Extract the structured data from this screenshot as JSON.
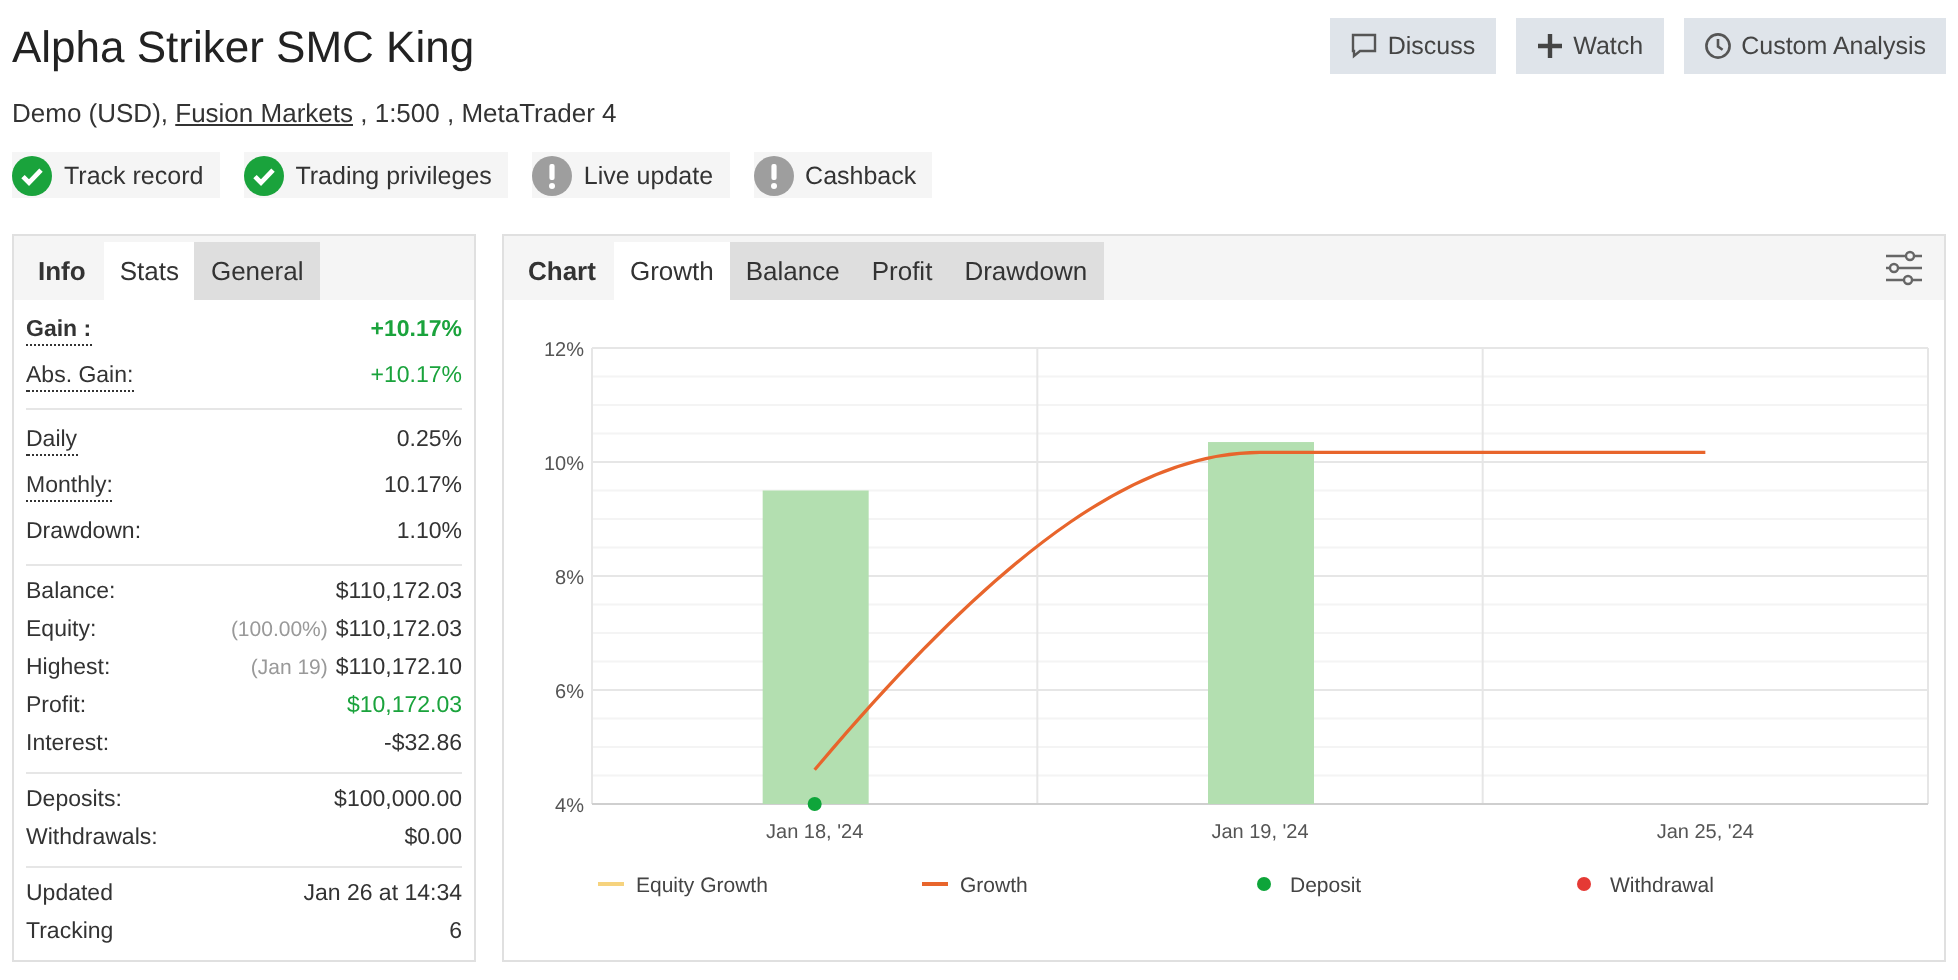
{
  "title": "Alpha Striker SMC King",
  "subtitle": {
    "before": "Demo (USD), ",
    "link": "Fusion Markets",
    "after": " , 1:500 , MetaTrader 4"
  },
  "actions": [
    {
      "label": "Discuss"
    },
    {
      "label": "Watch"
    },
    {
      "label": "Custom Analysis"
    }
  ],
  "badges": [
    {
      "label": "Track record",
      "verified": true
    },
    {
      "label": "Trading privileges",
      "verified": true
    },
    {
      "label": "Live update",
      "verified": false
    },
    {
      "label": "Cashback",
      "verified": false
    }
  ],
  "info_panel": {
    "heading": "Info",
    "tabs": [
      {
        "label": "Stats",
        "selected": true
      },
      {
        "label": "General",
        "selected": false
      }
    ],
    "groups": [
      [
        {
          "label": "Gain :",
          "value": "+10.17%",
          "dotted": true,
          "bold": true,
          "positive": true
        },
        {
          "label": "Abs. Gain:",
          "value": "+10.17%",
          "dotted": true,
          "bold": false,
          "positive": true
        }
      ],
      [
        {
          "label": "Daily",
          "value": "0.25%",
          "dotted": true,
          "bold": false,
          "positive": false
        },
        {
          "label": "Monthly:",
          "value": "10.17%",
          "dotted": true,
          "bold": false,
          "positive": false
        },
        {
          "label": "Drawdown:",
          "value": "1.10%",
          "dotted": false,
          "bold": false,
          "positive": false
        }
      ],
      [
        {
          "label": "Balance:",
          "value": "$110,172.03",
          "dotted": false,
          "bold": false,
          "positive": false
        },
        {
          "label": "Equity:",
          "note": "(100.00%)",
          "value": "$110,172.03",
          "dotted": false,
          "bold": false,
          "positive": false
        },
        {
          "label": "Highest:",
          "note": "(Jan 19)",
          "value": "$110,172.10",
          "dotted": false,
          "bold": false,
          "positive": false
        },
        {
          "label": "Profit:",
          "value": "$10,172.03",
          "dotted": false,
          "bold": false,
          "positive": true
        },
        {
          "label": "Interest:",
          "value": "-$32.86",
          "dotted": false,
          "bold": false,
          "positive": false
        }
      ],
      [
        {
          "label": "Deposits:",
          "value": "$100,000.00",
          "dotted": false,
          "bold": false,
          "positive": false
        },
        {
          "label": "Withdrawals:",
          "value": "$0.00",
          "dotted": false,
          "bold": false,
          "positive": false
        }
      ],
      [
        {
          "label": "Updated",
          "value": "Jan 26 at 14:34",
          "dotted": false,
          "bold": false,
          "positive": false
        },
        {
          "label": "Tracking",
          "value": "6",
          "dotted": false,
          "bold": false,
          "positive": false
        }
      ]
    ]
  },
  "chart_panel": {
    "heading": "Chart",
    "tabs": [
      {
        "label": "Growth",
        "selected": true
      },
      {
        "label": "Balance",
        "selected": false
      },
      {
        "label": "Profit",
        "selected": false
      },
      {
        "label": "Drawdown",
        "selected": false
      }
    ],
    "chart_data": {
      "type": "bar",
      "categories": [
        "Jan 18, '24",
        "Jan 19, '24",
        "Jan 25, '24"
      ],
      "ylim": [
        4,
        12
      ],
      "grid": true,
      "legend": "bottom",
      "yticks": [
        {
          "value": 4,
          "label": "4%"
        },
        {
          "value": 6,
          "label": "6%"
        },
        {
          "value": 8,
          "label": "8%"
        },
        {
          "value": 10,
          "label": "10%"
        },
        {
          "value": 12,
          "label": "12%"
        }
      ],
      "series": [
        {
          "color": "#b3dfb0",
          "values": [
            9.5,
            10.35,
            null
          ]
        },
        {
          "name": "Equity Growth",
          "type": "line",
          "color": "#f6d37e",
          "values": [
            null,
            null,
            null
          ]
        },
        {
          "name": "Growth",
          "type": "line",
          "color": "#e8652c",
          "values": [
            4.6,
            10.17,
            10.17
          ]
        },
        {
          "name": "Deposit",
          "type": "scatter",
          "color": "#0ea53a",
          "values": [
            4,
            null,
            null
          ]
        },
        {
          "name": "Withdrawal",
          "type": "scatter",
          "color": "#e53935",
          "values": [
            null,
            null,
            null
          ]
        }
      ]
    }
  }
}
